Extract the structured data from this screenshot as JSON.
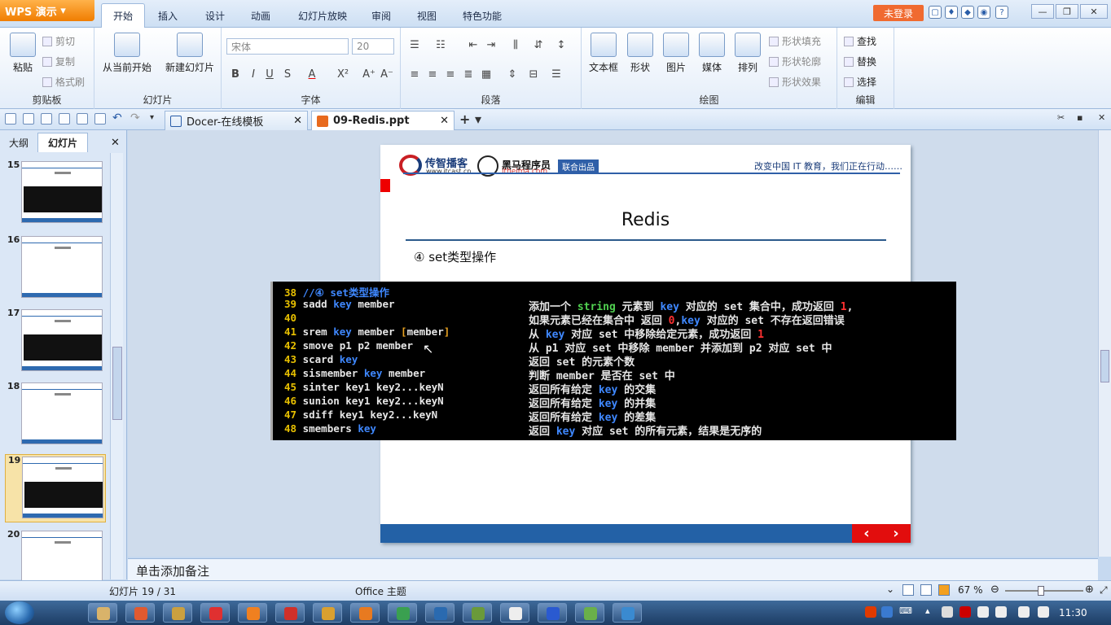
{
  "app": {
    "name": "WPS 演示",
    "login_label": "未登录"
  },
  "menu_tabs": [
    "开始",
    "插入",
    "设计",
    "动画",
    "幻灯片放映",
    "审阅",
    "视图",
    "特色功能"
  ],
  "ribbon": {
    "clipboard": {
      "group": "剪贴板",
      "paste": "粘贴",
      "cut": "剪切",
      "copy": "复制",
      "format_painter": "格式刷"
    },
    "slides": {
      "group": "幻灯片",
      "from_current": "从当前开始",
      "new_slide": "新建幻灯片"
    },
    "font": {
      "group": "字体",
      "font_name": "宋体",
      "font_size": "20"
    },
    "paragraph": {
      "group": "段落"
    },
    "drawing": {
      "group": "绘图",
      "textbox": "文本框",
      "shape": "形状",
      "picture": "图片",
      "media": "媒体",
      "arrange": "排列",
      "fill": "形状填充",
      "outline": "形状轮廓",
      "effect": "形状效果"
    },
    "edit": {
      "group": "编辑",
      "find": "查找",
      "replace": "替换",
      "select": "选择"
    }
  },
  "doc_tabs": [
    {
      "label": "Docer-在线模板",
      "active": false
    },
    {
      "label": "09-Redis.ppt",
      "active": true
    }
  ],
  "left_panel": {
    "tabs": [
      "大纲",
      "幻灯片"
    ],
    "thumbs": [
      {
        "num": "15",
        "selected": false
      },
      {
        "num": "16",
        "selected": false
      },
      {
        "num": "17",
        "selected": false
      },
      {
        "num": "18",
        "selected": false
      },
      {
        "num": "19",
        "selected": true
      },
      {
        "num": "20",
        "selected": false
      }
    ]
  },
  "slide": {
    "logo1": "传智播客",
    "logo1_url": "www.itcast.cn",
    "logo2": "黑马程序员",
    "logo2_url": "itheima.com",
    "joint": "联合出品",
    "slogan": "改变中国 IT 教育，我们正在行动……",
    "title": "Redis",
    "subtitle": "④ set类型操作",
    "code_lines": [
      {
        "n": "38",
        "cmd": "//④ set类型操作",
        "desc": ""
      },
      {
        "n": "39",
        "cmd": "sadd key member",
        "desc": "添加一个 string 元素到 key 对应的 set 集合中，成功返回 1,"
      },
      {
        "n": "40",
        "cmd": "",
        "desc": "如果元素已经在集合中 返回 0,key 对应的 set 不存在返回错误"
      },
      {
        "n": "41",
        "cmd": "srem key member [member]",
        "desc": "从 key 对应 set 中移除给定元素，成功返回 1"
      },
      {
        "n": "42",
        "cmd": "smove p1 p2 member",
        "desc": "从 p1 对应 set 中移除 member 并添加到 p2 对应 set 中"
      },
      {
        "n": "43",
        "cmd": "scard key",
        "desc": "返回 set 的元素个数"
      },
      {
        "n": "44",
        "cmd": "sismember key member",
        "desc": "判断 member 是否在 set 中"
      },
      {
        "n": "45",
        "cmd": "sinter key1 key2...keyN",
        "desc": "返回所有给定 key 的交集"
      },
      {
        "n": "46",
        "cmd": "sunion key1 key2...keyN",
        "desc": "返回所有给定 key 的并集"
      },
      {
        "n": "47",
        "cmd": "sdiff key1 key2...keyN",
        "desc": "返回所有给定 key 的差集"
      },
      {
        "n": "48",
        "cmd": "smembers key",
        "desc": "返回 key 对应 set 的所有元素，结果是无序的"
      }
    ]
  },
  "notes_placeholder": "单击添加备注",
  "status": {
    "slide_counter": "幻灯片 19 / 31",
    "theme": "Office 主题",
    "zoom": "67 %"
  },
  "taskbar": {
    "time": "11:30"
  },
  "colors": {
    "accent": "#2361a6",
    "nav_red": "#e20d0d",
    "wps_orange": "#f07d00"
  }
}
